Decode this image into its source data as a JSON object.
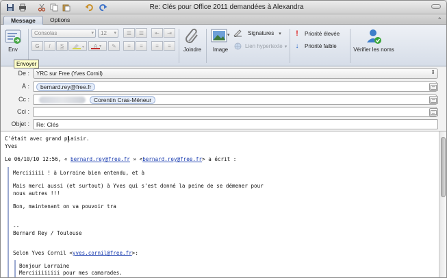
{
  "window": {
    "title": "Re: Clés pour Office 2011 demandées à Alexandra"
  },
  "quick_access": {
    "icons": [
      "save-icon",
      "print-icon",
      "cut-icon",
      "copy-icon",
      "paste-icon",
      "undo-icon",
      "redo-icon"
    ]
  },
  "tabs": [
    {
      "label": "Message",
      "active": true
    },
    {
      "label": "Options",
      "active": false
    }
  ],
  "ribbon": {
    "send_label": "Env",
    "font_name": "Consolas",
    "font_size": "12",
    "format_buttons": [
      "G",
      "I",
      "S",
      "A",
      "✎"
    ],
    "attach_label": "Joindre",
    "image_label": "Image",
    "signatures_label": "Signatures",
    "hyperlink_label": "Lien hypertexte",
    "priority_high_label": "Priorité élevée",
    "priority_low_label": "Priorité faible",
    "check_names_label": "Vérifier les noms"
  },
  "tooltip": {
    "text": "Envoyer"
  },
  "headers": {
    "from": {
      "label": "De :",
      "value": "YRC sur Free (Yves Cornil)"
    },
    "to": {
      "label": "À :",
      "tokens": [
        "bernard.rey@free.fr"
      ]
    },
    "cc": {
      "label": "Cc :",
      "tokens": [
        "Corentin Cras-Méneur"
      ]
    },
    "bcc": {
      "label": "Cci :"
    },
    "subject": {
      "label": "Objet :",
      "value": "Re: Clés"
    }
  },
  "body": {
    "greeting_line1": "C'était avec grand plaisir.",
    "greeting_line2": "Yves",
    "attribution_prefix": "Le 06/10/10 12:56, « ",
    "attribution_link": "bernard.rey@free.fr",
    "attribution_mid": " » <",
    "attribution_link2": "bernard.rey@free.fr",
    "attribution_suffix": "> a écrit :",
    "quote_lines": [
      "Merciiiiii ! à Lorraine bien entendu, et à",
      "Mais merci aussi (et surtout) à Yves qui s'est donné la peine de se démener pour",
      "nous autres !!!",
      "Bon, maintenant on va pouvoir tra",
      "--",
      "Bernard Rey / Toulouse"
    ],
    "selon_prefix": "Selon Yves Cornil <",
    "selon_link": "yves.cornil@free.fr",
    "selon_suffix": ">:",
    "nested_lines": [
      "Bonjour Lorraine",
      "Merciiiiiiiii pour mes camarades."
    ]
  },
  "colors": {
    "link": "#1a3db0",
    "quote_bar": "#9aa8d0",
    "ribbon_top": "#eef1f6",
    "token_bg": "#e6eefb"
  }
}
